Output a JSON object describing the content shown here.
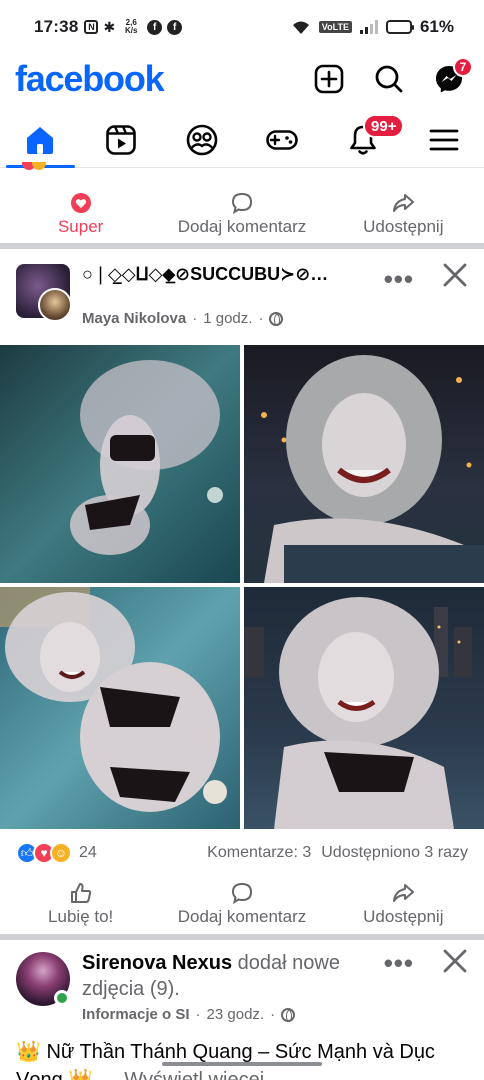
{
  "status_bar": {
    "time": "17:38",
    "network_speed": "2,6 K/s",
    "volte": "VoLTE",
    "battery": "61%",
    "battery_level": 0.61
  },
  "header": {
    "logo": "facebook",
    "messenger_badge": "7"
  },
  "nav": {
    "tabs": [
      "home",
      "video",
      "friends",
      "gaming",
      "notifications",
      "menu"
    ],
    "notifications_badge": "99+",
    "active_tab": "home"
  },
  "prev_post_actions": {
    "super": "Super",
    "comment": "Dodaj komentarz",
    "share": "Udostępnij"
  },
  "post": {
    "group_name": "○❘◇̲◇⨿◇⬥̲⊘SUCCUBU≻⊘…",
    "author": "Maya Nikolova",
    "separator": "·",
    "time": "1 godz.",
    "more": "•••",
    "reactions_count": "24",
    "comments": "Komentarze: 3",
    "shares": "Udostępniono 3 razy",
    "actions": {
      "like": "Lubię to!",
      "comment": "Dodaj komentarz",
      "share": "Udostępnij"
    }
  },
  "next_post": {
    "author": "Sirenova Nexus",
    "action": " dodał nowe zdjęcia (9).",
    "meta_label": "Informacje o SI",
    "separator": "·",
    "time": "23 godz.",
    "more": "•••",
    "text": "👑 Nữ Thần Thánh Quang – Sức Mạnh và Dục Vọng 👑",
    "see_more": "… Wyświetl więcej"
  },
  "colors": {
    "brand": "#0866ff",
    "badge": "#e41e3f",
    "super": "#f33e58",
    "secondary_text": "#65676b"
  }
}
